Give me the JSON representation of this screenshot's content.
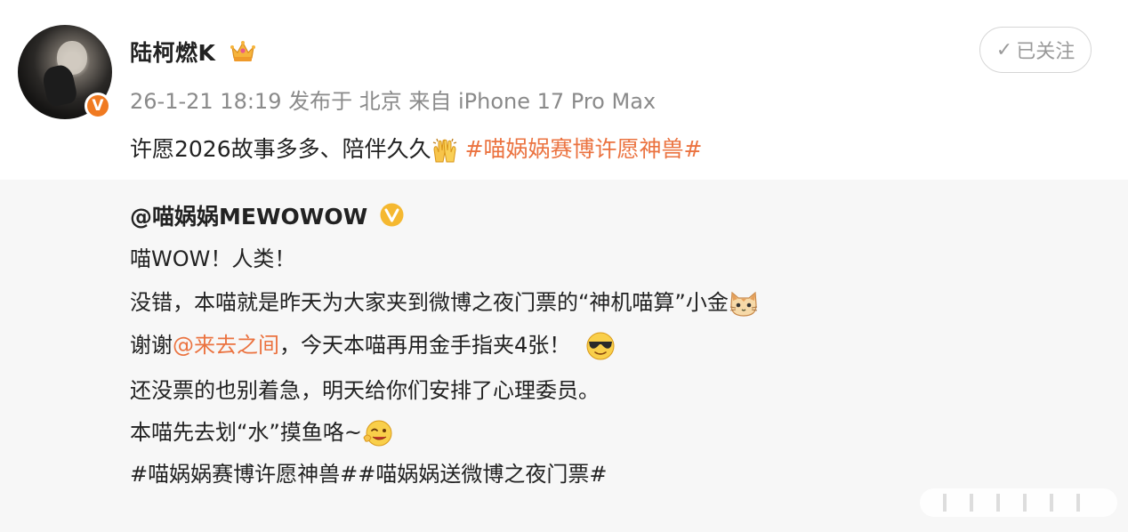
{
  "author": {
    "name": "陆柯燃K",
    "verified_badge": "V",
    "crown_icon": "crown-icon"
  },
  "meta": "26-1-21 18:19  发布于 北京  来自 iPhone 17 Pro Max",
  "follow_button": {
    "check": "✓",
    "label": "已关注"
  },
  "post": {
    "text": "许愿2026故事多多、陪伴久久",
    "emoji": "raised-hands-icon",
    "hashtag": "#喵娲娲赛博许愿神兽#"
  },
  "repost": {
    "user": "@喵娲娲MEWOWOW",
    "lines": {
      "l1": "喵WOW！人类！",
      "l2": "没错，本喵就是昨天为大家夹到微博之夜门票的“神机喵算”小金",
      "l3_prefix": "谢谢",
      "l3_mention": "@来去之间",
      "l3_suffix": "，今天本喵再用金手指夹4张！",
      "l4": "还没票的也别着急，明天给你们安排了心理委员。",
      "l5": "本喵先去划“水”摸鱼咯~",
      "hashtags": "#喵娲娲赛博许愿神兽##喵娲娲送微博之夜门票#"
    }
  },
  "colors": {
    "accent": "#eb7340",
    "verified_orange": "#f07a21",
    "verified_yellow": "#f5b830",
    "meta_gray": "#8a8a8a",
    "repost_bg": "#f7f7f7"
  }
}
